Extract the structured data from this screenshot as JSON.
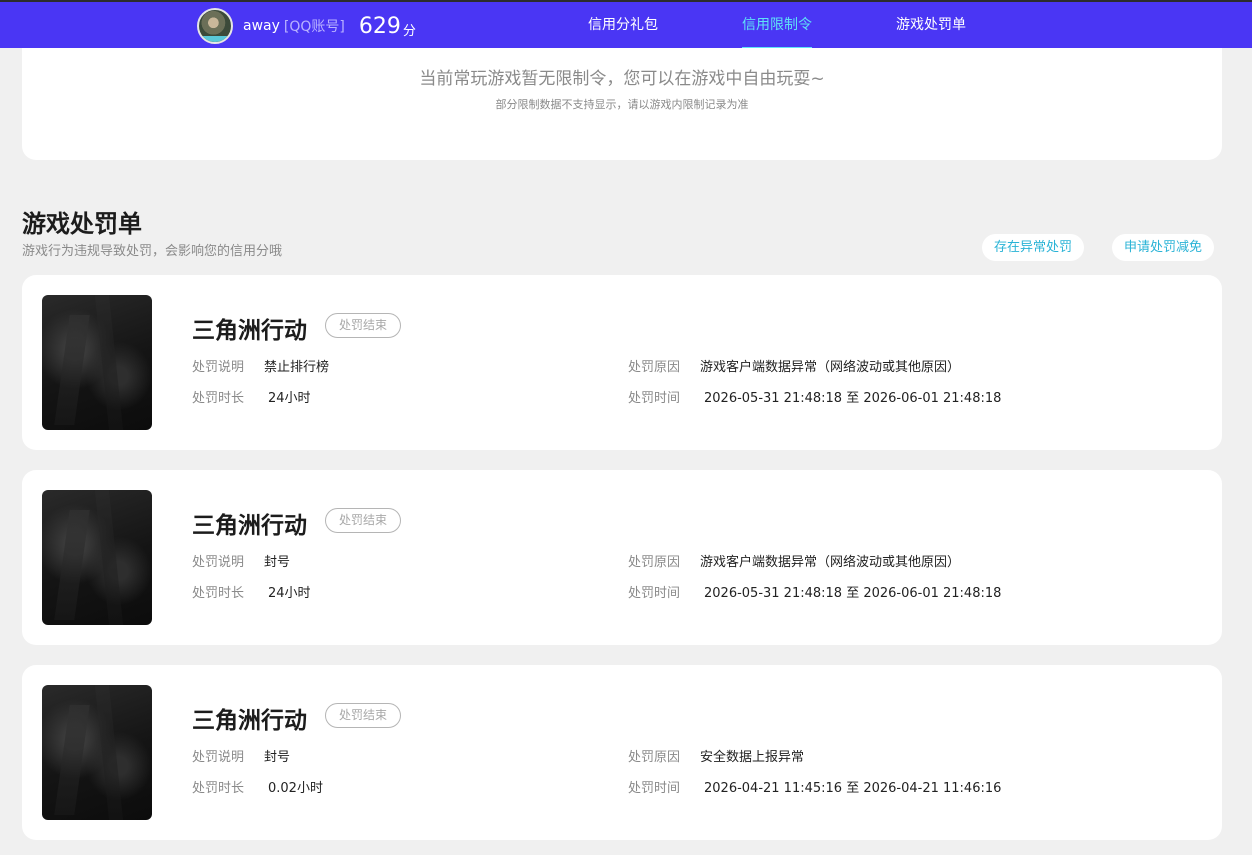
{
  "header": {
    "username": "away",
    "account_type": "[QQ账号]",
    "score": "629",
    "score_unit": "分",
    "nav": [
      {
        "label": "信用分礼包",
        "active": false
      },
      {
        "label": "信用限制令",
        "active": true
      },
      {
        "label": "游戏处罚单",
        "active": false
      }
    ],
    "accent_color": "#4a36f4",
    "active_color": "#5fe3f7"
  },
  "restriction": {
    "message": "当前常玩游戏暂无限制令，您可以在游戏中自由玩耍~",
    "note": "部分限制数据不支持显示，请以游戏内限制记录为准"
  },
  "penalty_section": {
    "title": "游戏处罚单",
    "description": "游戏行为违规导致处罚，会影响您的信用分哦",
    "buttons": {
      "abnormal": "存在异常处罚",
      "appeal": "申请处罚减免"
    },
    "field_labels": {
      "description": "处罚说明",
      "duration": "处罚时长",
      "reason": "处罚原因",
      "time": "处罚时间"
    },
    "items": [
      {
        "game": "三角洲行动",
        "status": "处罚结束",
        "description": "禁止排行榜",
        "duration": "24小时",
        "reason": "游戏客户端数据异常（网络波动或其他原因）",
        "time": "2026-05-31 21:48:18 至 2026-06-01 21:48:18"
      },
      {
        "game": "三角洲行动",
        "status": "处罚结束",
        "description": "封号",
        "duration": "24小时",
        "reason": "游戏客户端数据异常（网络波动或其他原因）",
        "time": "2026-05-31 21:48:18 至 2026-06-01 21:48:18"
      },
      {
        "game": "三角洲行动",
        "status": "处罚结束",
        "description": "封号",
        "duration": "0.02小时",
        "reason": "安全数据上报异常",
        "time": "2026-04-21 11:45:16 至 2026-04-21 11:46:16"
      }
    ]
  }
}
